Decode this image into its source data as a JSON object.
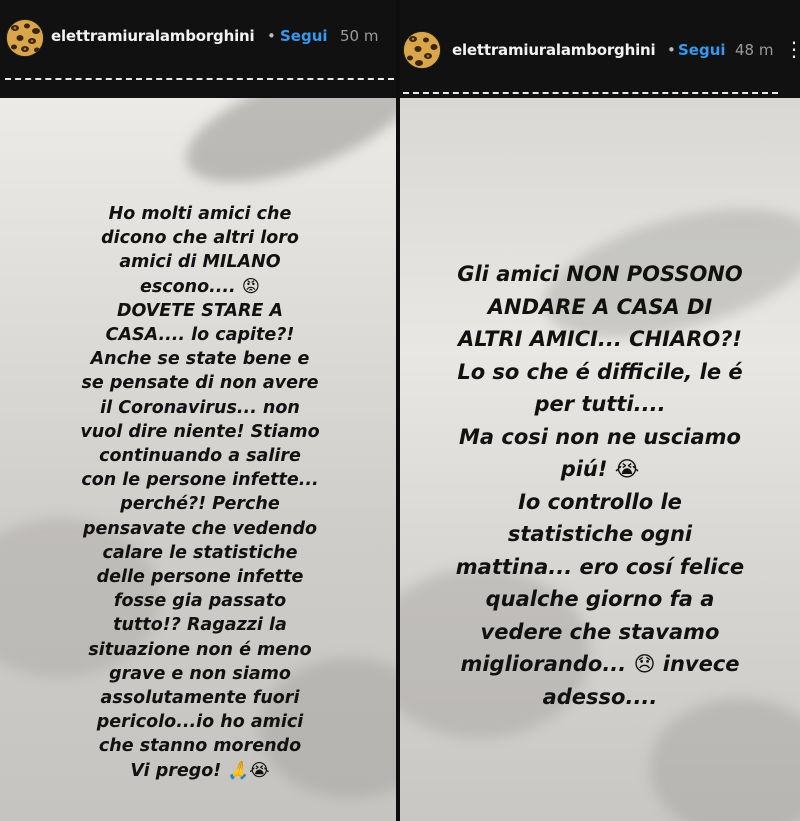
{
  "left_story": {
    "header": {
      "username": "elettramiuralamborghini",
      "separator": "•",
      "follow_label": "Segui",
      "time": "50 m"
    },
    "text": "Ho molti amici che\ndicono che altri loro\namici di MILANO\nescono.... 😡\nDOVETE STARE A\nCASA.... lo capite?!\nAnche se state bene e\nse pensate di non avere\nil Coronavirus... non\nvuol dire niente! Stiamo\ncontinuando a salire\ncon le persone infette...\nperché?! Perche\npensavate che vedendo\ncalare le statistiche\ndelle persone infette\nfosse gia passato\ntutto!? Ragazzi la\nsituazione non é meno\ngrave e non siamo\nassolutamente fuori\npericolo...io ho amici\nche stanno morendo\nVi prego! 🙏😭"
  },
  "right_story": {
    "header": {
      "username": "elettramiuralamborghini",
      "separator": "•",
      "follow_label": "Segui",
      "time": "48 m",
      "more_label": "⋮"
    },
    "text": "Gli amici NON POSSONO\nANDARE A CASA DI\nALTRI AMICI... CHIARO?!\nLo so che é difficile, le é\nper tutti....\nMa cosi non ne usciamo\npiú! 😭\nIo controllo le\nstatistiche ogni\nmattina... ero cosí felice\nqualche giorno fa a\nvedere che stavamo\nmigliorando... 😞 invece\nadesso...."
  },
  "colors": {
    "header_bg": "#111111",
    "follow": "#3897f0",
    "text": "#111111"
  },
  "icons": {
    "avatar": "leopard-print-avatar",
    "more": "more-options-icon"
  }
}
